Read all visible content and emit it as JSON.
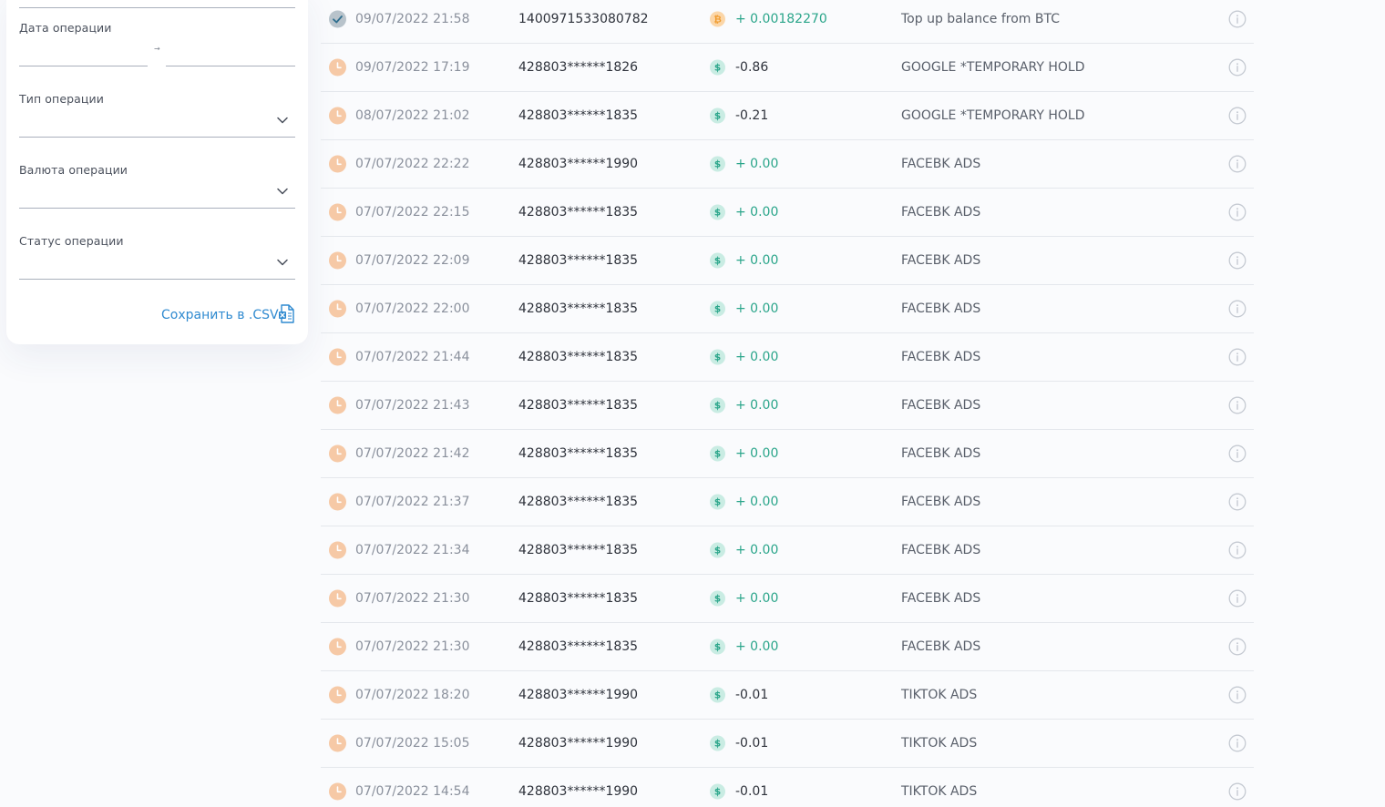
{
  "filters": {
    "date_label": "Дата операции",
    "date_arrow": "→",
    "type_label": "Тип операции",
    "currency_label": "Валюта операции",
    "status_label": "Статус операции",
    "save_csv_label": "Сохранить в .CSV"
  },
  "colors": {
    "pending": "#f6c9a6",
    "pending_mark": "#ffffff",
    "completed": "#b8c3cb",
    "usd_badge": "#c9ece3",
    "usd_mark": "#2aa58a",
    "btc_badge": "#fbd6a8",
    "btc_mark": "#ef9a2c",
    "positive_amount": "#2aa58a",
    "link": "#2f8ad0"
  },
  "transactions": [
    {
      "status": "completed",
      "date": "09/07/2022 21:58",
      "card": "1400971533080782",
      "currency": "btc",
      "currency_symbol": "₿",
      "amount": "+ 0.00182270",
      "positive": true,
      "description": "Top up balance from BTC"
    },
    {
      "status": "pending",
      "date": "09/07/2022 17:19",
      "card": "428803******1826",
      "currency": "usd",
      "currency_symbol": "$",
      "amount": "-0.86",
      "positive": false,
      "description": "GOOGLE *TEMPORARY HOLD"
    },
    {
      "status": "pending",
      "date": "08/07/2022 21:02",
      "card": "428803******1835",
      "currency": "usd",
      "currency_symbol": "$",
      "amount": "-0.21",
      "positive": false,
      "description": "GOOGLE *TEMPORARY HOLD"
    },
    {
      "status": "pending",
      "date": "07/07/2022 22:22",
      "card": "428803******1990",
      "currency": "usd",
      "currency_symbol": "$",
      "amount": "+ 0.00",
      "positive": true,
      "description": "FACEBK ADS"
    },
    {
      "status": "pending",
      "date": "07/07/2022 22:15",
      "card": "428803******1835",
      "currency": "usd",
      "currency_symbol": "$",
      "amount": "+ 0.00",
      "positive": true,
      "description": "FACEBK ADS"
    },
    {
      "status": "pending",
      "date": "07/07/2022 22:09",
      "card": "428803******1835",
      "currency": "usd",
      "currency_symbol": "$",
      "amount": "+ 0.00",
      "positive": true,
      "description": "FACEBK ADS"
    },
    {
      "status": "pending",
      "date": "07/07/2022 22:00",
      "card": "428803******1835",
      "currency": "usd",
      "currency_symbol": "$",
      "amount": "+ 0.00",
      "positive": true,
      "description": "FACEBK ADS"
    },
    {
      "status": "pending",
      "date": "07/07/2022 21:44",
      "card": "428803******1835",
      "currency": "usd",
      "currency_symbol": "$",
      "amount": "+ 0.00",
      "positive": true,
      "description": "FACEBK ADS"
    },
    {
      "status": "pending",
      "date": "07/07/2022 21:43",
      "card": "428803******1835",
      "currency": "usd",
      "currency_symbol": "$",
      "amount": "+ 0.00",
      "positive": true,
      "description": "FACEBK ADS"
    },
    {
      "status": "pending",
      "date": "07/07/2022 21:42",
      "card": "428803******1835",
      "currency": "usd",
      "currency_symbol": "$",
      "amount": "+ 0.00",
      "positive": true,
      "description": "FACEBK ADS"
    },
    {
      "status": "pending",
      "date": "07/07/2022 21:37",
      "card": "428803******1835",
      "currency": "usd",
      "currency_symbol": "$",
      "amount": "+ 0.00",
      "positive": true,
      "description": "FACEBK ADS"
    },
    {
      "status": "pending",
      "date": "07/07/2022 21:34",
      "card": "428803******1835",
      "currency": "usd",
      "currency_symbol": "$",
      "amount": "+ 0.00",
      "positive": true,
      "description": "FACEBK ADS"
    },
    {
      "status": "pending",
      "date": "07/07/2022 21:30",
      "card": "428803******1835",
      "currency": "usd",
      "currency_symbol": "$",
      "amount": "+ 0.00",
      "positive": true,
      "description": "FACEBK ADS"
    },
    {
      "status": "pending",
      "date": "07/07/2022 21:30",
      "card": "428803******1835",
      "currency": "usd",
      "currency_symbol": "$",
      "amount": "+ 0.00",
      "positive": true,
      "description": "FACEBK ADS"
    },
    {
      "status": "pending",
      "date": "07/07/2022 18:20",
      "card": "428803******1990",
      "currency": "usd",
      "currency_symbol": "$",
      "amount": "-0.01",
      "positive": false,
      "description": "TIKTOK ADS"
    },
    {
      "status": "pending",
      "date": "07/07/2022 15:05",
      "card": "428803******1990",
      "currency": "usd",
      "currency_symbol": "$",
      "amount": "-0.01",
      "positive": false,
      "description": "TIKTOK ADS"
    },
    {
      "status": "pending",
      "date": "07/07/2022 14:54",
      "card": "428803******1990",
      "currency": "usd",
      "currency_symbol": "$",
      "amount": "-0.01",
      "positive": false,
      "description": "TIKTOK ADS"
    }
  ]
}
